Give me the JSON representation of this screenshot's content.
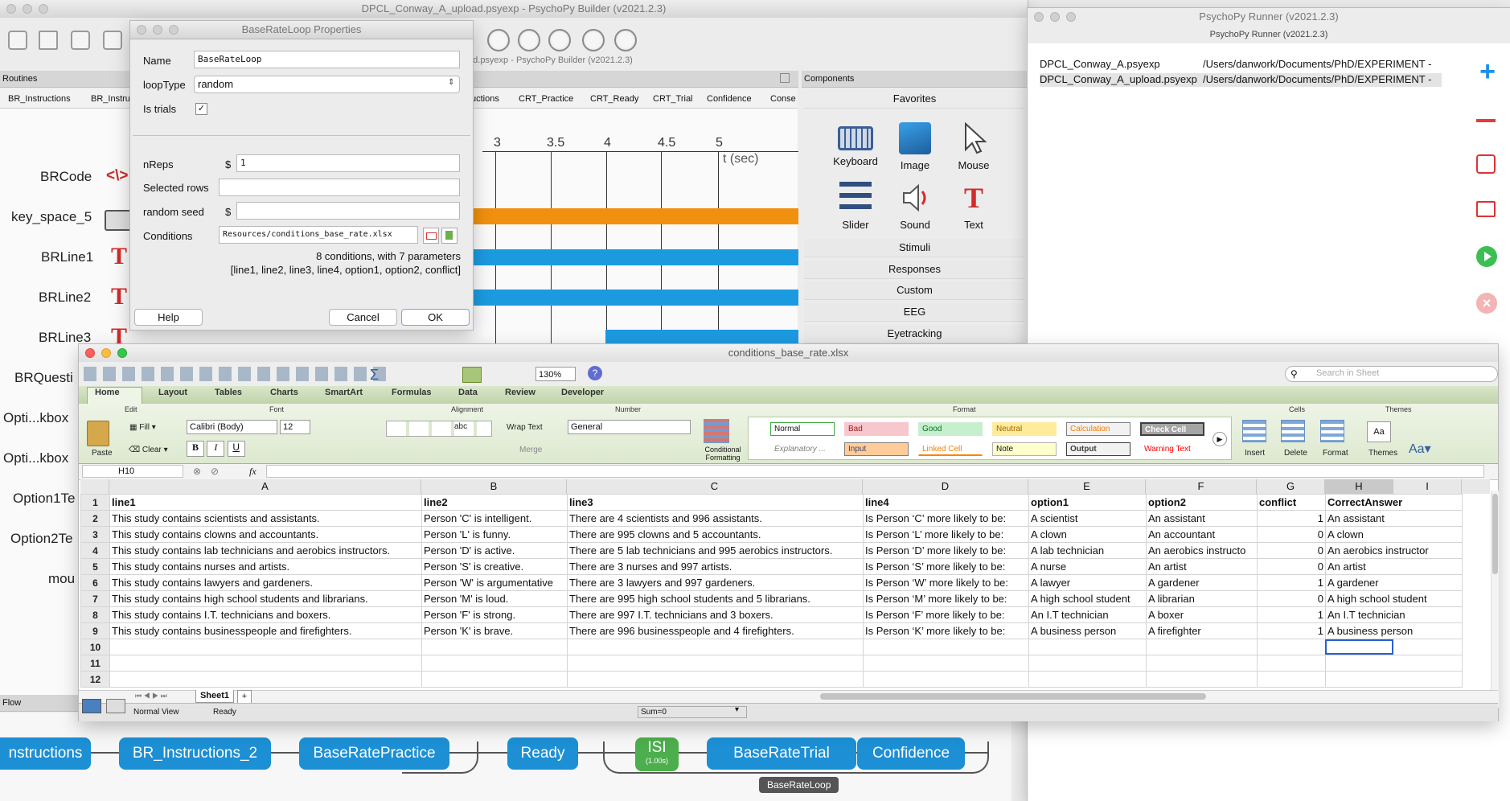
{
  "builder": {
    "title": "DPCL_Conway_A_upload.psyexp - PsychoPy Builder (v2021.2.3)",
    "inner_title": "d.psyexp - PsychoPy Builder (v2021.2.3)",
    "routines_label": "Routines",
    "routine_tabs": [
      "BR_Instructions",
      "BR_Instru",
      "uctions",
      "CRT_Practice",
      "CRT_Ready",
      "CRT_Trial",
      "Confidence",
      "Conse"
    ],
    "components": [
      "BRCode",
      "key_space_5",
      "BRLine1",
      "BRLine2",
      "BRLine3",
      "BRQuesti",
      "Opti...kbox",
      "Opti...kbox",
      "Option1Te",
      "Option2Te",
      "mou"
    ],
    "timeline_ticks": [
      "3",
      "3.5",
      "4",
      "4.5",
      "5"
    ],
    "t_label": "t (sec)",
    "code_glyph": "<\\>",
    "flow_label": "Flow",
    "flow_items": [
      "nstructions",
      "BR_Instructions_2",
      "BaseRatePractice",
      "Ready",
      "ISI",
      "BaseRateTrial",
      "Confidence"
    ],
    "isi_sub": "(1.00s)",
    "loop_label": "BaseRateLoop"
  },
  "components_panel": {
    "title": "Components",
    "favorites": "Favorites",
    "items": [
      "Keyboard",
      "Image",
      "Mouse",
      "Slider",
      "Sound",
      "Text"
    ],
    "categories": [
      "Stimuli",
      "Responses",
      "Custom",
      "EEG",
      "Eyetracking"
    ]
  },
  "dialog": {
    "title": "BaseRateLoop Properties",
    "name_label": "Name",
    "name_value": "BaseRateLoop",
    "looptype_label": "loopType",
    "looptype_value": "random",
    "istrials_label": "Is trials",
    "istrials_check": "✓",
    "nreps_label": "nReps",
    "nreps_value": "1",
    "selected_label": "Selected rows",
    "seed_label": "random seed",
    "dollar": "$",
    "conditions_label": "Conditions",
    "conditions_value": "Resources/conditions_base_rate.xlsx",
    "info1": "8 conditions, with 7 parameters",
    "info2": "[line1, line2, line3, line4, option1, option2, conflict]",
    "help": "Help",
    "cancel": "Cancel",
    "ok": "OK"
  },
  "runner": {
    "title": "PsychoPy Runner (v2021.2.3)",
    "subtitle": "PsychoPy Runner (v2021.2.3)",
    "rows": [
      {
        "file": "DPCL_Conway_A.psyexp",
        "path": "/Users/danwork/Documents/PhD/EXPERIMENT -"
      },
      {
        "file": "DPCL_Conway_A_upload.psyexp",
        "path": "/Users/danwork/Documents/PhD/EXPERIMENT -"
      }
    ]
  },
  "excel": {
    "title": "conditions_base_rate.xlsx",
    "zoom": "130%",
    "search_placeholder": "Search in Sheet",
    "tabs": [
      "Home",
      "Layout",
      "Tables",
      "Charts",
      "SmartArt",
      "Formulas",
      "Data",
      "Review",
      "Developer"
    ],
    "groups": [
      "Edit",
      "Font",
      "Alignment",
      "Number",
      "Format",
      "Cells",
      "Themes"
    ],
    "paste": "Paste",
    "fill": "Fill",
    "clear": "Clear",
    "font_name": "Calibri (Body)",
    "font_size": "12",
    "wrap_text": "Wrap Text",
    "merge": "Merge",
    "abc": "abc",
    "number_format": "General",
    "cond_format": "Conditional Formatting",
    "styles": [
      "Normal",
      "Bad",
      "Good",
      "Neutral",
      "Calculation",
      "Check Cell",
      "Explanatory ...",
      "Input",
      "Linked Cell",
      "Note",
      "Output",
      "Warning Text"
    ],
    "cells_btns": [
      "Insert",
      "Delete",
      "Format"
    ],
    "themes_btn": "Themes",
    "cell_ref": "H10",
    "fx": "fx",
    "col_letters": [
      "A",
      "B",
      "C",
      "D",
      "E",
      "F",
      "G",
      "H",
      "I"
    ],
    "rows": [
      [
        "line1",
        "line2",
        "line3",
        "line4",
        "option1",
        "option2",
        "conflict",
        "CorrectAnswer"
      ],
      [
        "This study contains scientists and assistants.",
        "Person 'C' is intelligent.",
        "There are 4 scientists and 996 assistants.",
        "Is Person ‘C’ more likely to be:",
        "A scientist",
        "An assistant",
        "1",
        "An assistant"
      ],
      [
        "This study contains clowns and accountants.",
        "Person 'L' is funny.",
        "There are 995 clowns and 5 accountants.",
        "Is Person ‘L’ more likely to be:",
        "A clown",
        "An accountant",
        "0",
        "A clown"
      ],
      [
        "This study contains lab technicians and aerobics instructors.",
        "Person 'D' is active.",
        "There are 5 lab technicians and 995 aerobics instructors.",
        "Is Person ‘D’ more likely to be:",
        "A lab technician",
        "An aerobics instructo",
        "0",
        "An aerobics instructor"
      ],
      [
        "This study contains nurses and artists.",
        "Person 'S' is creative.",
        "There are 3 nurses and 997 artists.",
        "Is Person ‘S’ more likely to be:",
        "A nurse",
        "An artist",
        "0",
        "An artist"
      ],
      [
        "This study contains lawyers and gardeners.",
        "Person 'W' is argumentative",
        "There are 3 lawyers and 997 gardeners.",
        "Is Person ‘W’ more likely to be:",
        "A lawyer",
        "A gardener",
        "1",
        "A gardener"
      ],
      [
        "This study contains high school students and librarians.",
        "Person 'M' is loud.",
        "There are 995 high school students and 5 librarians.",
        "Is Person ‘M’ more likely to be:",
        "A high school student",
        "A librarian",
        "0",
        "A high school student"
      ],
      [
        "This study contains I.T. technicians and boxers.",
        "Person 'F' is strong.",
        "There are 997 I.T. technicians and 3 boxers.",
        "Is Person ‘F’ more likely to be:",
        "An I.T technician",
        "A boxer",
        "1",
        "An I.T technician"
      ],
      [
        "This study contains businesspeople and firefighters.",
        "Person 'K' is brave.",
        "There are 996 businesspeople and 4 firefighters.",
        "Is Person ‘K’ more likely to be:",
        "A business person",
        "A firefighter",
        "1",
        "A business person"
      ],
      [
        "",
        "",
        "",
        "",
        "",
        "",
        "",
        ""
      ],
      [
        "",
        "",
        "",
        "",
        "",
        "",
        "",
        ""
      ],
      [
        "",
        "",
        "",
        "",
        "",
        "",
        "",
        ""
      ]
    ],
    "sheet_tab": "Sheet1",
    "normal_view": "Normal View",
    "ready": "Ready",
    "sum": "Sum=0"
  },
  "colors": {
    "accent": "#1c8fd5",
    "orange": "#f0900e",
    "excel_green": "#6a9a3c"
  }
}
